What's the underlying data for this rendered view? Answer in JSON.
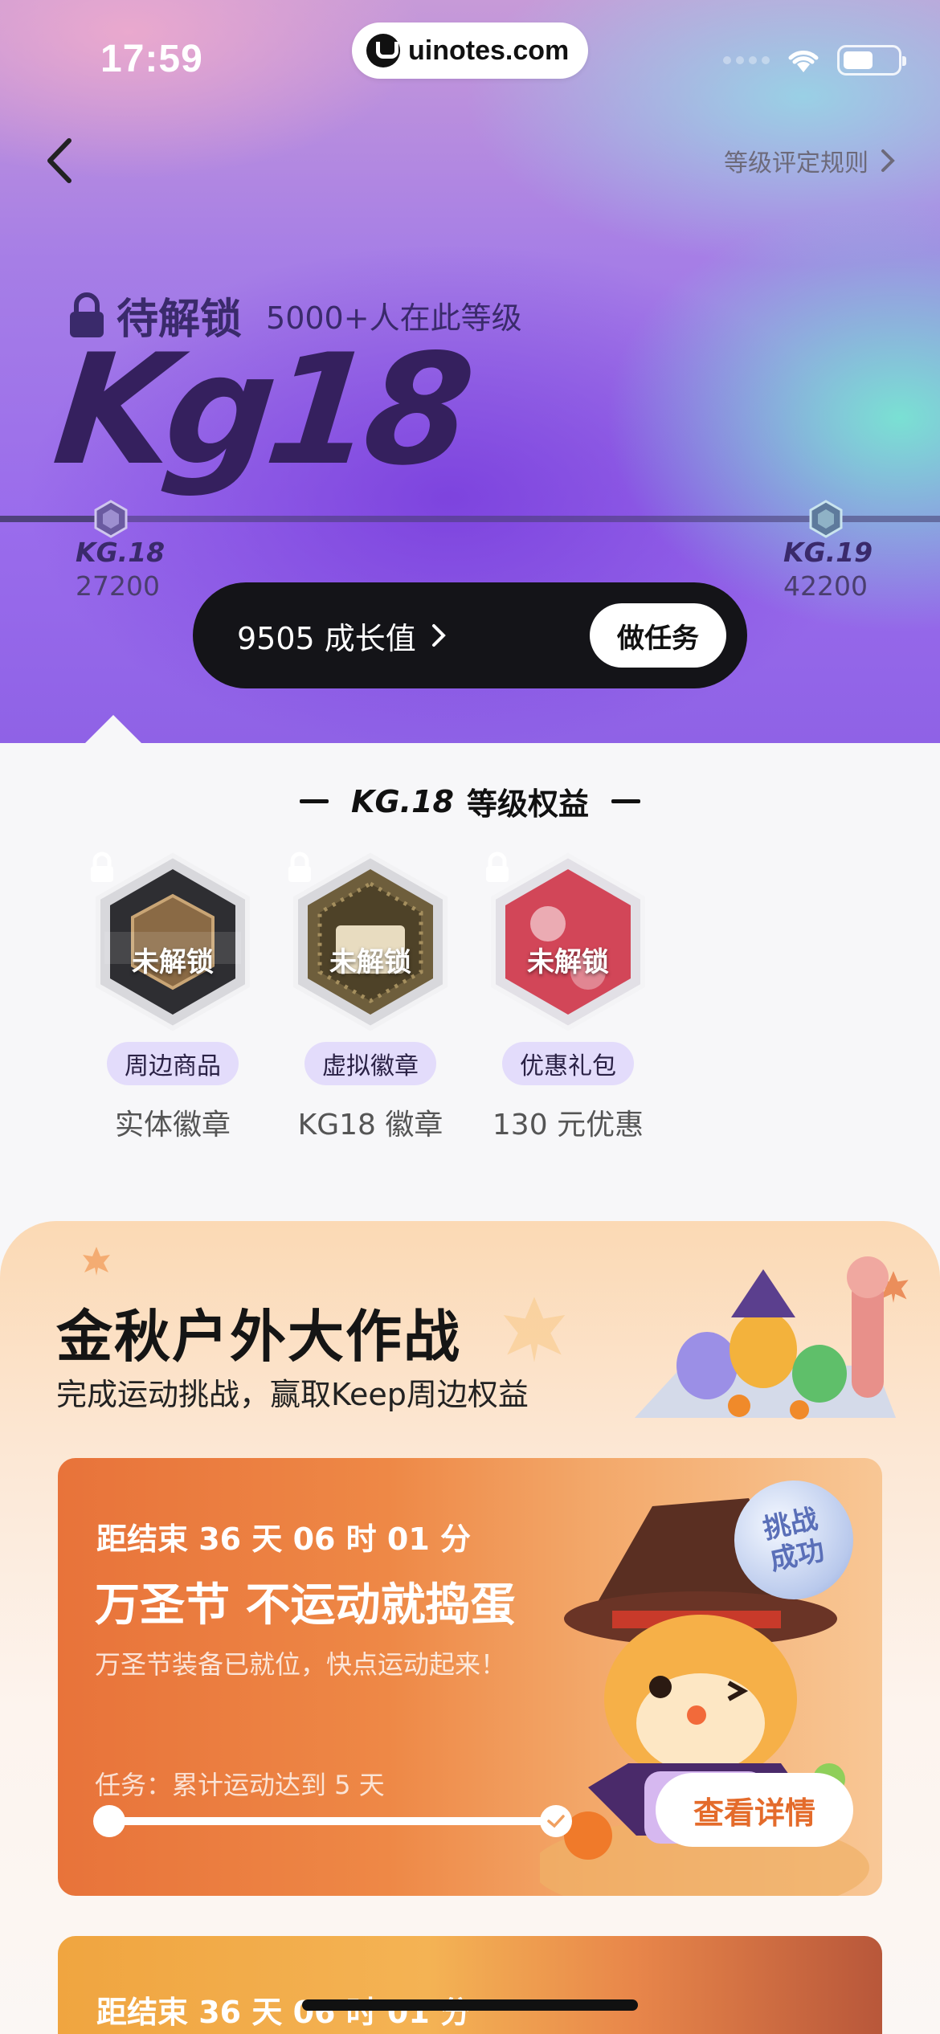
{
  "status": {
    "time": "17:59",
    "url": "uinotes.com"
  },
  "header": {
    "rules_link": "等级评定规则"
  },
  "level": {
    "lock_status": "待解锁",
    "users_at_level": "5000+人在此等级",
    "big_label": "Kg18",
    "current_node": {
      "label": "KG.18",
      "value": "27200"
    },
    "next_node": {
      "label": "KG.19",
      "value": "42200"
    },
    "growth_text": "9505 成长值",
    "task_button": "做任务"
  },
  "benefits": {
    "title_level": "KG.18",
    "title_text": "等级权益",
    "lock_overlay": "未解锁",
    "items": [
      {
        "tag": "周边商品",
        "desc": "实体徽章",
        "color": "#3a3a3a"
      },
      {
        "tag": "虚拟徽章",
        "desc": "KG18 徽章",
        "color": "#6b5a3a"
      },
      {
        "tag": "优惠礼包",
        "desc": "130 元优惠",
        "color": "#d24658"
      }
    ]
  },
  "campaign": {
    "title": "金秋户外大作战",
    "subtitle": "完成运动挑战，赢取Keep周边权益",
    "card1": {
      "countdown": "距结束 36 天 06 时 01 分",
      "title": "万圣节 不运动就捣蛋",
      "subtitle": "万圣节装备已就位，快点运动起来！",
      "task": "任务：累计运动达到 5 天",
      "progress": 1.0,
      "detail_button": "查看详情",
      "stamp": "挑战成功"
    },
    "card2": {
      "countdown": "距结束 36 天 06 时 01 分"
    }
  }
}
